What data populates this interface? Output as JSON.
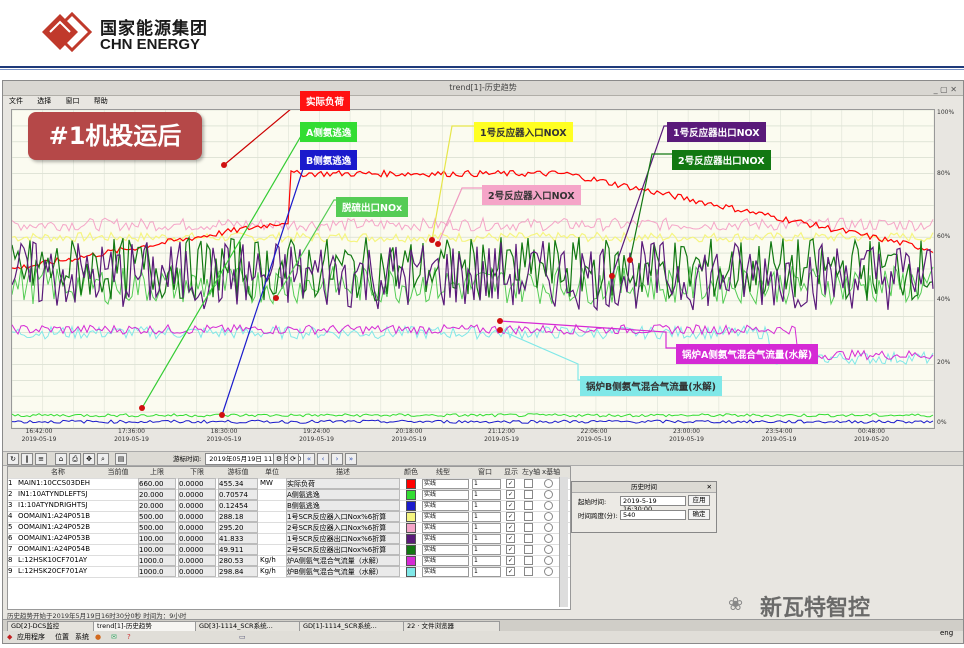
{
  "brand": {
    "cn": "国家能源集团",
    "en": "CHN ENERGY"
  },
  "window": {
    "title": "trend[1]-历史趋势",
    "menu": [
      "文件",
      "选择",
      "窗口",
      "帮助"
    ]
  },
  "badge": "#1机投运后",
  "callouts": {
    "load": "实际负荷",
    "a_slip": "A侧氨逃逸",
    "b_slip": "B侧氨逃逸",
    "r1_in": "1号反应器入口NOX",
    "r1_out": "1号反应器出口NOX",
    "r2_out": "2号反应器出口NOX",
    "r2_in": "2号反应器入口NOX",
    "desulf": "脱硫出口NOx",
    "boiler_a": "锅炉A侧氨气混合气流量(水解)",
    "boiler_b": "锅炉B侧氨气混合气流量(水解)"
  },
  "colors": {
    "load": "#ff0000",
    "a_slip": "#33dd33",
    "b_slip": "#1a1acc",
    "r1_in": "#f5f580",
    "r1_out": "#5a1a7a",
    "r2_out": "#127812",
    "r2_in": "#f5a5c8",
    "desulf": "#55cc55",
    "boiler_a": "#d52ad5",
    "boiler_b": "#80e8e8"
  },
  "y_ticks": [
    "100%",
    "80%",
    "60%",
    "40%",
    "20%",
    "0%"
  ],
  "x_ticks": [
    {
      "t": "16:42:00",
      "d": "2019-05-19"
    },
    {
      "t": "17:36:00",
      "d": "2019-05-19"
    },
    {
      "t": "18:30:00",
      "d": "2019-05-19"
    },
    {
      "t": "19:24:00",
      "d": "2019-05-19"
    },
    {
      "t": "20:18:00",
      "d": "2019-05-19"
    },
    {
      "t": "21:12:00",
      "d": "2019-05-19"
    },
    {
      "t": "22:06:00",
      "d": "2019-05-19"
    },
    {
      "t": "23:00:00",
      "d": "2019-05-19"
    },
    {
      "t": "23:54:00",
      "d": "2019-05-19"
    },
    {
      "t": "00:48:00",
      "d": "2019-05-20"
    }
  ],
  "toolbar": {
    "cursor_label": "游标时间:",
    "cursor_value": "2019年05月19日 11:08:54: 0"
  },
  "table": {
    "headers": {
      "name": "名称",
      "current": "当前值",
      "upper": "上限",
      "lower": "下限",
      "cursor": "游标值",
      "unit": "单位",
      "desc": "描述",
      "color": "颜色",
      "linetype": "线型",
      "window": "窗口",
      "show": "显示",
      "left": "左y轴",
      "x": "x基轴"
    },
    "rows": [
      {
        "n": "1",
        "name": "MAIN1:10CCS03DEH",
        "upper": "660.00",
        "lower": "0.0000",
        "cursor": "455.34",
        "unit": "MW",
        "desc": "实际负荷",
        "color": "#ff0000",
        "line": "实线",
        "win": "1"
      },
      {
        "n": "2",
        "name": "IN1:10ATYNDLEFTSJ",
        "upper": "20.000",
        "lower": "0.0000",
        "cursor": "0.70574",
        "unit": "",
        "desc": "A侧氨逃逸",
        "color": "#33dd33",
        "line": "实线",
        "win": "1"
      },
      {
        "n": "3",
        "name": "I1:10ATYNDRIGHTSJ",
        "upper": "20.000",
        "lower": "0.0000",
        "cursor": "0.12454",
        "unit": "",
        "desc": "B侧氨逃逸",
        "color": "#1a1acc",
        "line": "实线",
        "win": "1"
      },
      {
        "n": "4",
        "name": "OOMAIN1:A24P051B",
        "upper": "500.00",
        "lower": "0.0000",
        "cursor": "288.18",
        "unit": "",
        "desc": "1号SCR反应器入口Nox%6折算",
        "color": "#f5f580",
        "line": "实线",
        "win": "1"
      },
      {
        "n": "5",
        "name": "OOMAIN1:A24P052B",
        "upper": "500.00",
        "lower": "0.0000",
        "cursor": "295.20",
        "unit": "",
        "desc": "2号SCR反应器入口Nox%6折算",
        "color": "#f5a5c8",
        "line": "实线",
        "win": "1"
      },
      {
        "n": "6",
        "name": "OOMAIN1:A24P053B",
        "upper": "100.00",
        "lower": "0.0000",
        "cursor": "41.833",
        "unit": "",
        "desc": "1号SCR反应器出口Nox%6折算",
        "color": "#5a1a7a",
        "line": "实线",
        "win": "1"
      },
      {
        "n": "7",
        "name": "OOMAIN1:A24P054B",
        "upper": "100.00",
        "lower": "0.0000",
        "cursor": "49.911",
        "unit": "",
        "desc": "2号SCR反应器出口Nox%6折算",
        "color": "#127812",
        "line": "实线",
        "win": "1"
      },
      {
        "n": "8",
        "name": "L:12HSK10CF701AY",
        "upper": "1000.0",
        "lower": "0.0000",
        "cursor": "280.53",
        "unit": "Kg/h",
        "desc": "炉A侧氨气混合气流量（水解）",
        "color": "#d52ad5",
        "line": "实线",
        "win": "1"
      },
      {
        "n": "9",
        "name": "L:12HSK20CF701AY",
        "upper": "1000.0",
        "lower": "0.0000",
        "cursor": "298.84",
        "unit": "Kg/h",
        "desc": "炉B侧氨气混合气流量（水解）",
        "color": "#80e8e8",
        "line": "实线",
        "win": "1"
      }
    ]
  },
  "dialog": {
    "title": "历史时间",
    "start_label": "起始时间:",
    "start_value": "2019-5-19 16:30:00",
    "apply": "应用",
    "span_label": "时间跨度(分):",
    "span_value": "540",
    "ok": "确定"
  },
  "status": "历史趋势开始于2019年5月19日16时30分0秒  时间为：9小时",
  "tasks": [
    "GD[2]-DCS监控",
    "trend[1]-历史趋势",
    "GD[3]-1114_SCR系统...",
    "GD[1]-1114_SCR系统...",
    "22 · 文件浏览器"
  ],
  "sys": [
    "应用程序",
    "位置",
    "系统"
  ],
  "watermark": "新瓦特智控",
  "lang": "eng"
}
